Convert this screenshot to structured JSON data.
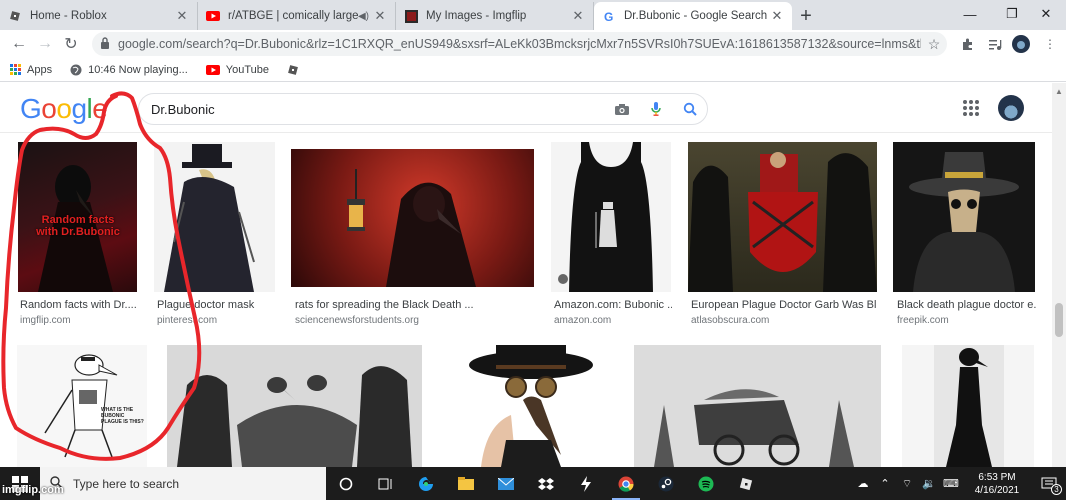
{
  "browser": {
    "tabs": [
      {
        "title": "Home - Roblox",
        "icon": "roblox-icon"
      },
      {
        "title": "r/ATBGE | comically large hat",
        "icon": "youtube-icon",
        "audio": true
      },
      {
        "title": "My Images - Imgflip",
        "icon": "imgflip-icon"
      },
      {
        "title": "Dr.Bubonic - Google Search",
        "icon": "google-icon",
        "active": true
      }
    ],
    "url": "google.com/search?q=Dr.Bubonic&rlz=1C1RXQR_enUS949&sxsrf=ALeKk03BmcksrjcMxr7n5SVRsI0h7SUEvA:1618613587132&source=lnms&tbm=isch&s...",
    "bookmarks": [
      {
        "label": "Apps",
        "icon": "apps-grid-icon"
      },
      {
        "label": "10:46 Now playing...",
        "icon": "globe-icon"
      },
      {
        "label": "YouTube",
        "icon": "youtube-icon"
      },
      {
        "label": "",
        "icon": "roblox-icon"
      }
    ]
  },
  "google": {
    "logo": [
      "G",
      "o",
      "o",
      "g",
      "l",
      "e"
    ],
    "query": "Dr.Bubonic"
  },
  "results": [
    {
      "caption": "Random facts with Dr....",
      "source": "imgflip.com",
      "overlay_text": "Random facts with Dr.Bubonic"
    },
    {
      "caption": "Plague doctor mask",
      "source": "pinterest.com"
    },
    {
      "caption": "rats for spreading the Black Death ...",
      "source": "sciencenewsforstudents.org"
    },
    {
      "caption": "Amazon.com: Bubonic ...",
      "source": "amazon.com"
    },
    {
      "caption": "European Plague Doctor Garb Was Bla...",
      "source": "atlasobscura.com"
    },
    {
      "caption": "Black death plague doctor e...",
      "source": "freepik.com"
    },
    {
      "caption": "",
      "source": "",
      "overlay_text": "WHAT IS THE BUBONIC PLAGUE IS THIS?"
    },
    {
      "caption": "",
      "source": ""
    },
    {
      "caption": "",
      "source": ""
    },
    {
      "caption": "",
      "source": ""
    },
    {
      "caption": "",
      "source": ""
    }
  ],
  "taskbar": {
    "search_placeholder": "Type here to search",
    "time": "6:53 PM",
    "date": "4/16/2021",
    "notification_count": "3",
    "watermark": "imgflip.com"
  },
  "colors": {
    "scribble": "#e8262b",
    "google_blue": "#4285f4",
    "taskbar": "#1c1c1c"
  }
}
